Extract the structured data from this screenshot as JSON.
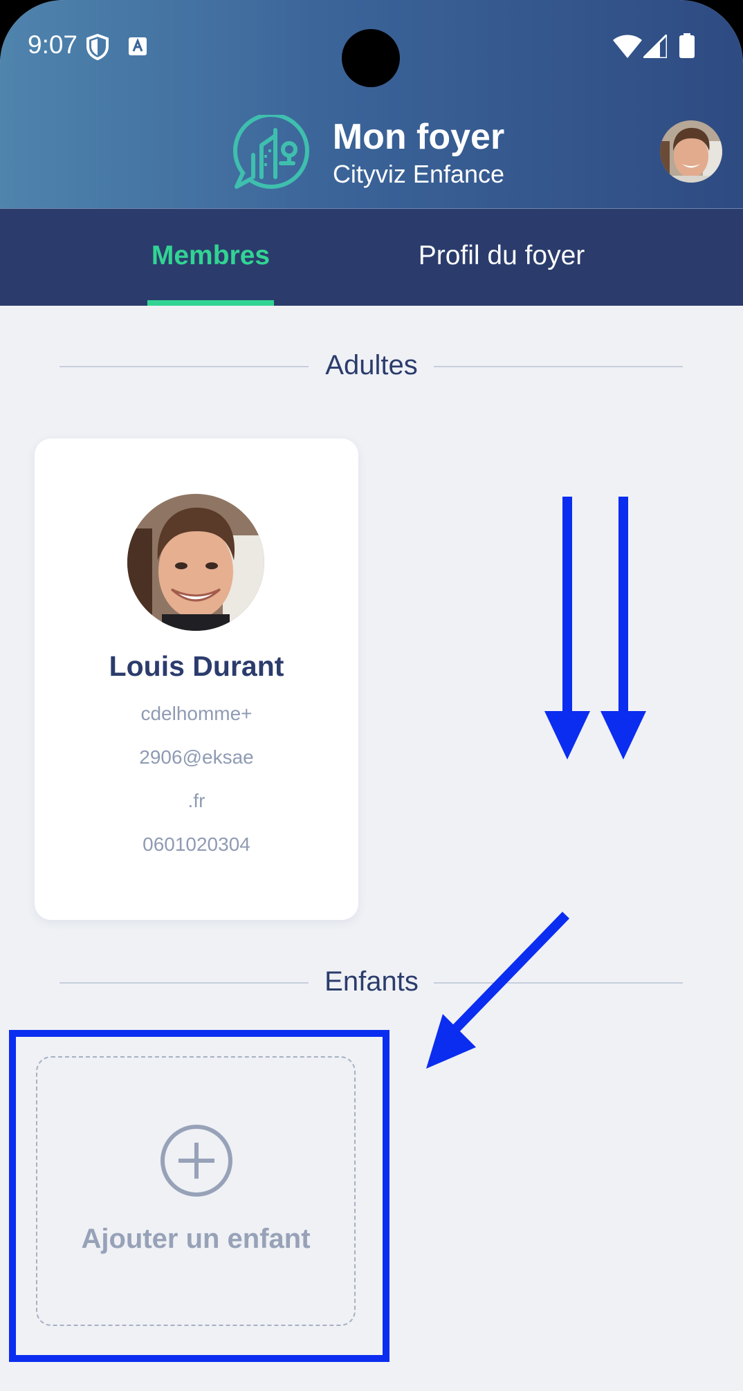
{
  "status_bar": {
    "time": "9:07"
  },
  "header": {
    "title": "Mon foyer",
    "subtitle": "Cityviz Enfance"
  },
  "tabs": [
    {
      "label": "Membres",
      "active": true
    },
    {
      "label": "Profil du foyer",
      "active": false
    }
  ],
  "sections": {
    "adults_label": "Adultes",
    "children_label": "Enfants"
  },
  "adult_card": {
    "name": "Louis Durant",
    "email_lines": [
      "cdelhomme+",
      "2906@eksae",
      ".fr"
    ],
    "phone": "0601020304"
  },
  "add_child": {
    "label": "Ajouter un enfant"
  },
  "colors": {
    "accent": "#32d493",
    "nav": "#2b3c6c",
    "annotation": "#0b2df0",
    "background": "#eff1f5"
  }
}
